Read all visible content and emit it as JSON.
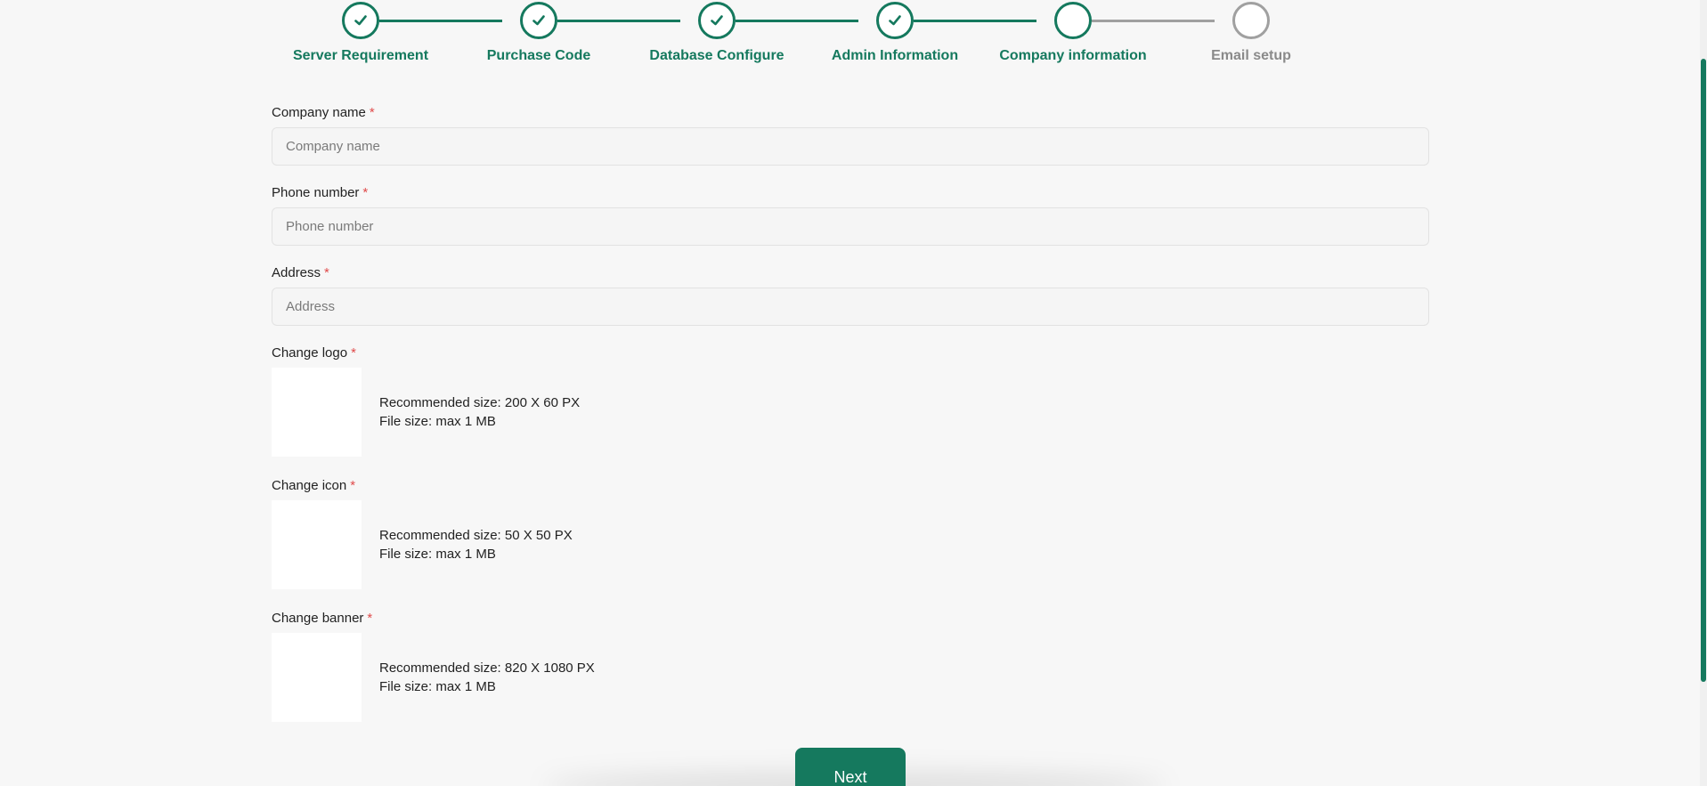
{
  "colors": {
    "accent": "#15795e",
    "pending": "#a0a0a0",
    "required": "#e04b4b",
    "background": "#f7f7f7"
  },
  "stepper": {
    "steps": [
      {
        "label": "Server Requirement",
        "status": "complete",
        "icon": "check-icon"
      },
      {
        "label": "Purchase Code",
        "status": "complete",
        "icon": "check-icon"
      },
      {
        "label": "Database Configure",
        "status": "complete",
        "icon": "check-icon"
      },
      {
        "label": "Admin Information",
        "status": "complete",
        "icon": "check-icon"
      },
      {
        "label": "Company information",
        "status": "current",
        "icon": ""
      },
      {
        "label": "Email setup",
        "status": "pending",
        "icon": ""
      }
    ]
  },
  "form": {
    "company_name": {
      "label": "Company name",
      "required": "*",
      "placeholder": "Company name",
      "value": ""
    },
    "phone_number": {
      "label": "Phone number",
      "required": "*",
      "placeholder": "Phone number",
      "value": ""
    },
    "address": {
      "label": "Address",
      "required": "*",
      "placeholder": "Address",
      "value": ""
    },
    "logo": {
      "label": "Change logo",
      "required": "*",
      "recommended": "Recommended size: 200 X 60 PX",
      "file_size": "File size: max 1 MB"
    },
    "icon": {
      "label": "Change icon",
      "required": "*",
      "recommended": "Recommended size: 50 X 50 PX",
      "file_size": "File size: max 1 MB"
    },
    "banner": {
      "label": "Change banner",
      "required": "*",
      "recommended": "Recommended size: 820 X 1080 PX",
      "file_size": "File size: max 1 MB"
    }
  },
  "actions": {
    "next_label": "Next"
  }
}
